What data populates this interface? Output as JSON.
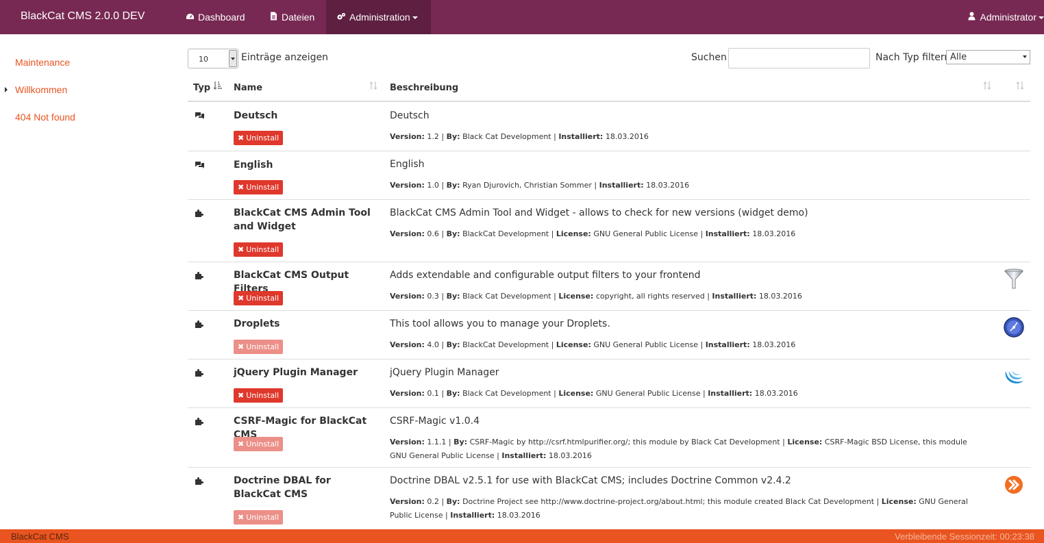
{
  "nav": {
    "brand": "BlackCat CMS 2.0.0 DEV",
    "dashboard": "Dashboard",
    "dateien": "Dateien",
    "administration": "Administration",
    "user": "Administrator"
  },
  "sidebar": {
    "items": [
      {
        "label": "Maintenance"
      },
      {
        "label": "Willkommen"
      },
      {
        "label": "404 Not found"
      }
    ]
  },
  "controls": {
    "page_length": "10",
    "page_length_label": "Einträge anzeigen",
    "search_label": "Suchen",
    "search_value": "",
    "filter_label": "Nach Typ filtern",
    "filter_value": "Alle"
  },
  "table": {
    "headers": {
      "type": "Typ",
      "name": "Name",
      "description": "Beschreibung"
    },
    "uninstall_label": "Uninstall",
    "meta_labels": {
      "version": "Version:",
      "by": "By:",
      "license": "License:",
      "installed": "Installiert:"
    },
    "rows": [
      {
        "type_icon": "comments-icon",
        "name": "Deutsch",
        "uninstall_disabled": false,
        "description": "Deutsch",
        "version": "1.2",
        "by": "Black Cat Development",
        "license": null,
        "installed": "18.03.2016",
        "icon": null
      },
      {
        "type_icon": "comments-icon",
        "name": "English",
        "uninstall_disabled": false,
        "description": "English",
        "version": "1.0",
        "by": "Ryan Djurovich, Christian Sommer",
        "license": null,
        "installed": "18.03.2016",
        "icon": null
      },
      {
        "type_icon": "puzzle-icon",
        "name": "BlackCat CMS Admin Tool and Widget",
        "uninstall_disabled": false,
        "description": "BlackCat CMS Admin Tool and Widget - allows to check for new versions (widget demo)",
        "version": "0.6",
        "by": "BlackCat Development",
        "license": "GNU General Public License",
        "installed": "18.03.2016",
        "icon": null
      },
      {
        "type_icon": "puzzle-icon",
        "name": "BlackCat CMS Output Filters",
        "uninstall_disabled": false,
        "description": "Adds extendable and configurable output filters to your frontend",
        "version": "0.3",
        "by": "Black Cat Development",
        "license": "copyright, all rights reserved",
        "installed": "18.03.2016",
        "icon": "funnel-icon"
      },
      {
        "type_icon": "puzzle-icon",
        "name": "Droplets",
        "uninstall_disabled": true,
        "description": "This tool allows you to manage your Droplets.",
        "version": "4.0",
        "by": "BlackCat Development",
        "license": "GNU General Public License",
        "installed": "18.03.2016",
        "icon": "droplets-icon"
      },
      {
        "type_icon": "puzzle-icon",
        "name": "jQuery Plugin Manager",
        "uninstall_disabled": false,
        "description": "jQuery Plugin Manager",
        "version": "0.1",
        "by": "Black Cat Development",
        "license": "GNU General Public License",
        "installed": "18.03.2016",
        "icon": "jquery-icon"
      },
      {
        "type_icon": "puzzle-icon",
        "name": "CSRF-Magic for BlackCat CMS",
        "uninstall_disabled": true,
        "description": "CSRF-Magic v1.0.4",
        "version": "1.1.1",
        "by": "CSRF-Magic by http://csrf.htmlpurifier.org/; this module by Black Cat Development",
        "license": "CSRF-Magic BSD License, this module GNU General Public License",
        "installed": "18.03.2016",
        "icon": null
      },
      {
        "type_icon": "puzzle-icon",
        "name": "Doctrine DBAL for BlackCat CMS",
        "uninstall_disabled": true,
        "description": "Doctrine DBAL v2.5.1 for use with BlackCat CMS; includes Doctrine Common v2.4.2",
        "version": "0.2",
        "by": "Doctrine Project see http://www.doctrine-project.org/about.html; this module created Black Cat Development",
        "license": "GNU General Public License",
        "installed": "18.03.2016",
        "icon": "doctrine-icon"
      }
    ]
  },
  "footer": {
    "left": "BlackCat CMS",
    "right": "Verbleibende Sessionzeit: 00:23:38"
  },
  "colors": {
    "navbar": "#772953",
    "navbar_active": "#5e1f41",
    "accent": "#e95420",
    "danger": "#df382c",
    "danger_disabled": "#ec8f88"
  }
}
